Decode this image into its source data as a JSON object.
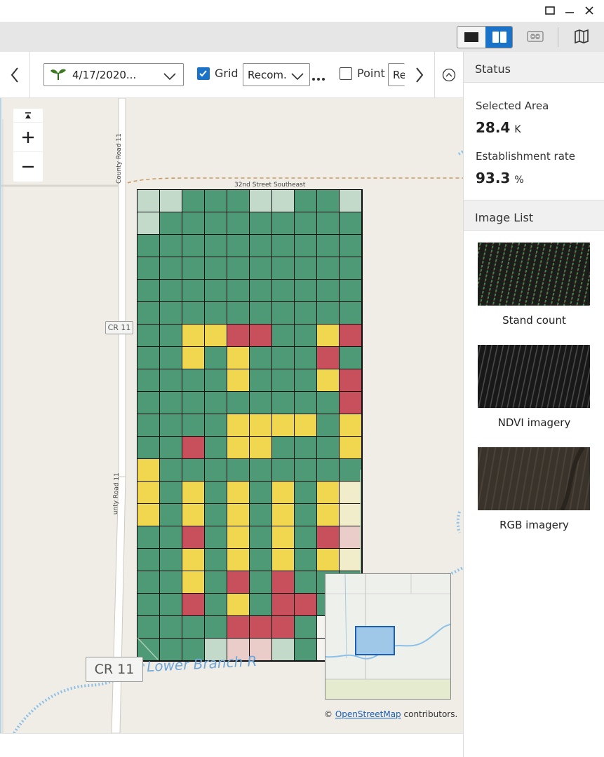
{
  "window": {
    "controls": [
      "maximize-icon",
      "minimize-icon",
      "close-icon"
    ]
  },
  "map_controls": {
    "date_value": "4/17/2020...",
    "grid_label": "Grid",
    "grid_checked": true,
    "recommend_value": "Recom.",
    "point_label": "Point",
    "point_checked": false,
    "second_select_value": "Re"
  },
  "map": {
    "road_county_11_upper": "County Road 11",
    "road_county_11_lower": "unty Road 11",
    "road_32nd": "32nd Street Southeast",
    "shield_small": "CR 11",
    "shield_large": "CR 11",
    "river": "Lower Branch R",
    "attribution_prefix": "©",
    "attribution_link": "OpenStreetMap",
    "attribution_suffix": "contributors.",
    "grid_colors": {
      "G": "#4f9a76",
      "Y": "#f1d64f",
      "R": "#c8505d",
      "L": "#c3d9c9",
      "P": "#eaccc8",
      "C": "#f1ecc9",
      "W": "#f4f3ef"
    },
    "grid_rows": [
      "LLGGGLLGGL",
      "LGGGGGGGGG",
      "GGGGGGGGGG",
      "GGGGGGGGGG",
      "GGGGGGGGGG",
      "GGGGGGGGGG",
      "GGYYRRGGYR",
      "GGYGYGGGRG",
      "GGGGYGGGYR",
      "GGGGGGGGGR",
      "GGGGYYYYGY",
      "GGRGYYGGGY",
      "YGGGGGGGGG",
      "YGYGYGYGYC",
      "YGYGYGYGYC",
      "GGRGYGYGRP",
      "GGYGYGYGYC",
      "GGYGRGRGGG",
      "GGRGYGRRGG",
      "GGGGRRRGWG",
      "GGGLPPLGWW"
    ]
  },
  "panel": {
    "status_title": "Status",
    "selected_area_label": "Selected Area",
    "selected_area_value": "28.4",
    "selected_area_unit": "K",
    "establishment_label": "Establishment rate",
    "establishment_value": "93.3",
    "establishment_unit": "%",
    "image_list_title": "Image List",
    "images": [
      {
        "label": "Stand count"
      },
      {
        "label": "NDVI imagery"
      },
      {
        "label": "RGB imagery"
      }
    ]
  }
}
